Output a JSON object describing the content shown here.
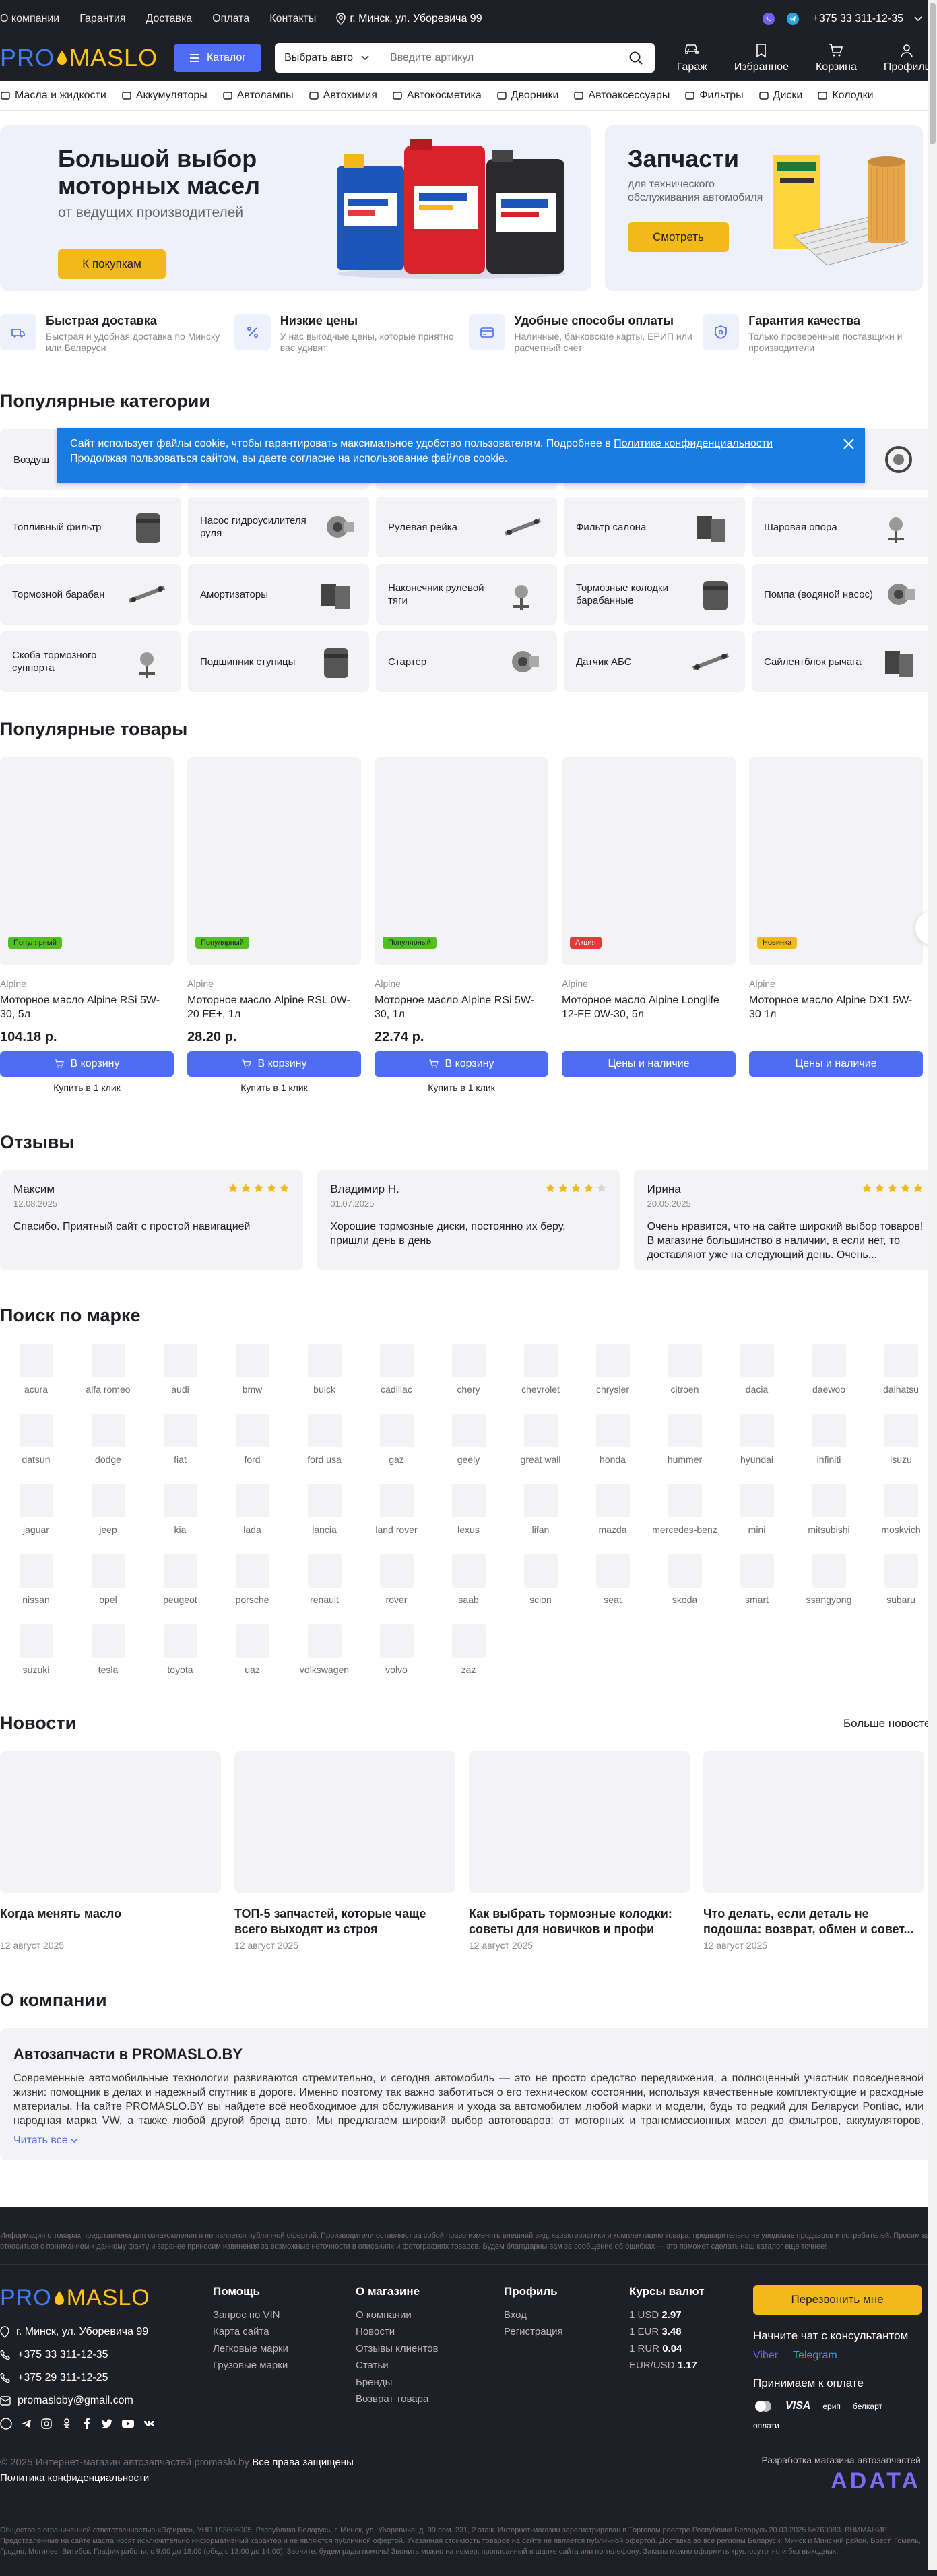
{
  "topbar": {
    "links": [
      "О компании",
      "Гарантия",
      "Доставка",
      "Оплата",
      "Контакты"
    ],
    "address": "г. Минск, ул. Уборевича 99",
    "phone": "+375 33 311-12-35"
  },
  "header": {
    "logo_pro": "PRO",
    "logo_maslo": "MASLO",
    "catalog_label": "Каталог",
    "search_select": "Выбрать авто",
    "search_placeholder": "Введите артикул",
    "icons": [
      {
        "label": "Гараж",
        "icon": "car-icon"
      },
      {
        "label": "Избранное",
        "icon": "bookmark-icon"
      },
      {
        "label": "Корзина",
        "icon": "cart-icon"
      },
      {
        "label": "Профиль",
        "icon": "user-icon"
      }
    ]
  },
  "nav": [
    "Масла и жидкости",
    "Аккумуляторы",
    "Автолампы",
    "Автохимия",
    "Автокосметика",
    "Дворники",
    "Автоаксессуары",
    "Фильтры",
    "Диски",
    "Колодки"
  ],
  "banners": {
    "left": {
      "title": "Большой выбор моторных масел",
      "subtitle": "от ведущих производителей",
      "button": "К покупкам"
    },
    "right": {
      "title": "Запчасти",
      "subtitle": "для технического обслуживания автомобиля",
      "button": "Смотреть"
    }
  },
  "features": [
    {
      "title": "Быстрая доставка",
      "desc": "Быстрая и удобная доставка по Минску или Беларуси"
    },
    {
      "title": "Низкие цены",
      "desc": "У нас выгодные цены, которые приятно вас удивят"
    },
    {
      "title": "Удобные способы оплаты",
      "desc": "Наличные, банковские карты, ЕРИП или расчетный счет"
    },
    {
      "title": "Гарантия качества",
      "desc": "Только проверенные поставщики и производители"
    }
  ],
  "categories": {
    "title": "Популярные категории",
    "row1_first": "Воздуш",
    "rows": [
      [
        "Топливный фильтр",
        "Насос гидроусилителя руля",
        "Рулевая рейка",
        "Фильтр салона",
        "Шаровая опора"
      ],
      [
        "Тормозной барабан",
        "Амортизаторы",
        "Наконечник рулевой тяги",
        "Тормозные колодки барабанные",
        "Помпа (водяной насос)"
      ],
      [
        "Скоба тормозного суппорта",
        "Подшипник ступицы",
        "Стартер",
        "Датчик АБС",
        "Сайлентблок рычага"
      ]
    ]
  },
  "cookie": {
    "text1": "Сайт использует файлы cookie, чтобы гарантировать максимальное удобство пользователям. Подробнее в ",
    "link": "Политике конфиденциальности",
    "text2": "Продолжая пользоваться сайтом, вы даете согласие на использование файлов cookie."
  },
  "products": {
    "title": "Популярные товары",
    "items": [
      {
        "badge": "Популярный",
        "badge_type": "pop",
        "brand": "Alpine",
        "name": "Моторное масло Alpine RSi 5W-30, 5л",
        "price": "104.18 р.",
        "button": "В корзину",
        "oneclick": "Купить в 1 клик"
      },
      {
        "badge": "Популярный",
        "badge_type": "pop",
        "brand": "Alpine",
        "name": "Моторное масло Alpine RSL 0W-20 FE+, 1л",
        "price": "28.20 р.",
        "button": "В корзину",
        "oneclick": "Купить в 1 клик"
      },
      {
        "badge": "Популярный",
        "badge_type": "pop",
        "brand": "Alpine",
        "name": "Моторное масло Alpine RSi 5W-30, 1л",
        "price": "22.74 р.",
        "button": "В корзину",
        "oneclick": "Купить в 1 клик"
      },
      {
        "badge": "Акция",
        "badge_type": "act",
        "brand": "Alpine",
        "name": "Моторное масло Alpine Longlife 12-FE 0W-30, 5л",
        "price": "",
        "button": "Цены и наличие",
        "oneclick": ""
      },
      {
        "badge": "Новинка",
        "badge_type": "new",
        "brand": "Alpine",
        "name": "Моторное масло Alpine DX1 5W-30 1л",
        "price": "",
        "button": "Цены и наличие",
        "oneclick": ""
      }
    ]
  },
  "reviews": {
    "title": "Отзывы",
    "items": [
      {
        "name": "Максим",
        "date": "12.08.2025",
        "text": "Спасибо. Приятный сайт с простой навигацией",
        "stars": 5
      },
      {
        "name": "Владимир Н.",
        "date": "01.07.2025",
        "text": "Хорошие тормозные диски, постоянно их беру, пришли день в день",
        "stars": 4
      },
      {
        "name": "Ирина",
        "date": "20.05.2025",
        "text": "Очень нравится, что на сайте широкий выбор товаров! В магазине большинство в наличии, а если нет, то доставляют уже на следующий день. Очень...",
        "stars": 5
      }
    ]
  },
  "brands": {
    "title": "Поиск по марке",
    "items": [
      "acura",
      "alfa romeo",
      "audi",
      "bmw",
      "buick",
      "cadillac",
      "chery",
      "chevrolet",
      "chrysler",
      "citroen",
      "dacia",
      "daewoo",
      "daihatsu",
      "datsun",
      "dodge",
      "fiat",
      "ford",
      "ford usa",
      "gaz",
      "geely",
      "great wall",
      "honda",
      "hummer",
      "hyundai",
      "infiniti",
      "isuzu",
      "jaguar",
      "jeep",
      "kia",
      "lada",
      "lancia",
      "land rover",
      "lexus",
      "lifan",
      "mazda",
      "mercedes-benz",
      "mini",
      "mitsubishi",
      "moskvich",
      "nissan",
      "opel",
      "peugeot",
      "porsche",
      "renault",
      "rover",
      "saab",
      "scion",
      "seat",
      "skoda",
      "smart",
      "ssangyong",
      "subaru",
      "suzuki",
      "tesla",
      "toyota",
      "uaz",
      "volkswagen",
      "volvo",
      "zaz"
    ]
  },
  "news": {
    "title": "Новости",
    "more": "Больше новостей",
    "items": [
      {
        "title": "Когда менять масло",
        "date": "12 август 2025"
      },
      {
        "title": "ТОП-5 запчастей, которые чаще всего выходят из строя",
        "date": "12 август 2025"
      },
      {
        "title": "Как выбрать тормозные колодки: советы для новичков и профи",
        "date": "12 август 2025"
      },
      {
        "title": "Что делать, если деталь не подошла: возврат, обмен и совет...",
        "date": "12 август 2025"
      }
    ]
  },
  "about": {
    "title": "О компании",
    "heading": "Автозапчасти в PROMASLO.BY",
    "text": "Современные автомобильные технологии развиваются стремительно, и сегодня автомобиль — это не просто средство передвижения, а полноценный участник повседневной жизни: помощник в делах и надежный спутник в дороге. Именно поэтому так важно заботиться о его техническом состоянии, используя качественные комплектующие и расходные материалы. На сайте PROMASLO.BY вы найдете всё необходимое для обслуживания и ухода за автомобилем любой марки и модели, будь то редкий для Беларуси Pontiac, или народная марка VW, а также любой другой бренд авто. Мы предлагаем широкий выбор автотоваров: от моторных и трансмиссионных масел до фильтров, аккумуляторов, автохимии и полезных аксессуаров. В каталоге есть шины, тормоза, свечи зажигания, ролик ремня, прокладк...",
    "more": "Читать все"
  },
  "disclaimer": "Информация о товарах представлена для ознакомления и не является публичной офертой. Производители оставляют за собой право изменять внешний вид, характеристики и комплектацию товара, предварительно не уведомив продавцов и потребителей. Просим вас относиться с пониманием к данному факту и заранее приносим извинения за возможные неточности в описаниях и фотографиях товаров. Будем благодарны вам за сообщение об ошибках — это поможет сделать наш каталог еще точнее!",
  "footer": {
    "address": "г. Минск, ул. Уборевича 99",
    "phone1": "+375 33 311-12-35",
    "phone2": "+375 29 311-12-25",
    "email": "promaslobу@gmail.com",
    "columns": [
      {
        "title": "Помощь",
        "links": [
          "Запрос по VIN",
          "Карта сайта",
          "Легковые марки",
          "Грузовые марки"
        ]
      },
      {
        "title": "О магазине",
        "links": [
          "О компании",
          "Новости",
          "Отзывы клиентов",
          "Статьи",
          "Бренды",
          "Возврат товара"
        ]
      },
      {
        "title": "Профиль",
        "links": [
          "Вход",
          "Регистрация"
        ]
      }
    ],
    "rates": {
      "title": "Курсы валют",
      "items": [
        [
          "1 USD",
          "2.97"
        ],
        [
          "1 EUR",
          "3.48"
        ],
        [
          "1 RUR",
          "0.04"
        ],
        [
          "EUR/USD",
          "1.17"
        ]
      ]
    },
    "callme": "Перезвонить мне",
    "chat_title": "Начните чат с консультантом",
    "chat_links": [
      "Viber",
      "Telegram"
    ],
    "pay_title": "Принимаем к оплате",
    "pay": [
      "VISA",
      "ерип",
      "белкарт",
      "оплати"
    ],
    "copyright": "© 2025 Интернет-магазин автозапчастей promaslo.by ",
    "rights": "Все права защищены",
    "policy": "Политика конфиденциальности",
    "dev_label": "Разработка магазина автозапчастей",
    "dev_brand": "ADATA",
    "legal": "Общество с ограниченной ответственностью «Эфирис», УНП 193806005, Республика Беларусь, г. Минск, ул. Уборевича, д. 99 пом. 231, 2 этаж. Интернет-магазин зарегистрирован в Торговом реестре Республики Беларусь 20.03.2025 №760083. ВНИМАНИЕ! Представленные на сайте масла носят исключительно информативный характер и не являются публичной офертой. Указанная стоимость товаров на сайте не является публичной офертой. Доставка во все регионы Беларуси: Минск и Минский район, Брест, Гомель, Гродно, Могилев, Витебск. График работы: с 9:00 до 18:00 (обед с 13:00 до 14:00). Звоните, будем рады помочь! Звонить можно на номер, прописанный в шапке сайта или по телефону: Заказы можно оформить круглосуточно и без выходных."
  },
  "colors": {
    "accent": "#4e6df2",
    "yellow": "#f3b81a",
    "dark": "#1f2026",
    "cookie": "#1a7be0"
  }
}
